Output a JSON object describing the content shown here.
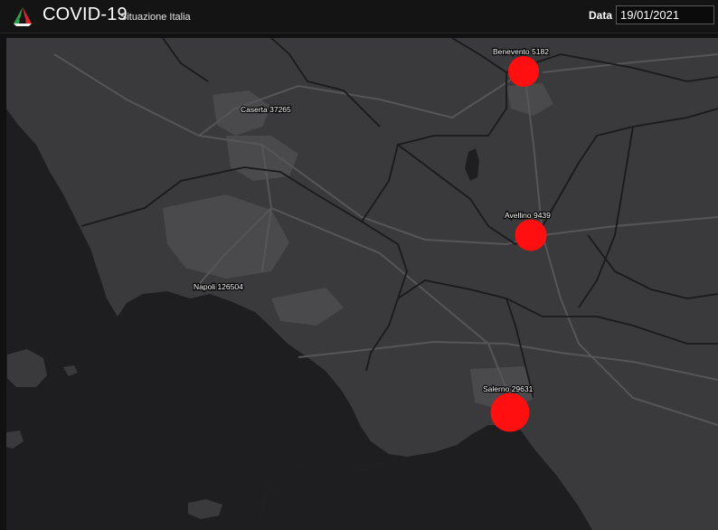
{
  "header": {
    "title": "COVID-19",
    "subtitle": "Situazione Italia",
    "date_label": "Data",
    "date_value": "19/01/2021",
    "logo_icon": "tricolor-triangle-logo-icon"
  },
  "map": {
    "marker_color": "#ff0f0f",
    "cities": [
      {
        "name": "Benevento",
        "cases": 5182,
        "label": "Benevento 5182"
      },
      {
        "name": "Caserta",
        "cases": 37265,
        "label": "Caserta 37265"
      },
      {
        "name": "Avellino",
        "cases": 9439,
        "label": "Avellino 9439"
      },
      {
        "name": "Napoli",
        "cases": 126504,
        "label": "Napoli 126504"
      },
      {
        "name": "Salerno",
        "cases": 29631,
        "label": "Salerno 29631"
      }
    ]
  }
}
